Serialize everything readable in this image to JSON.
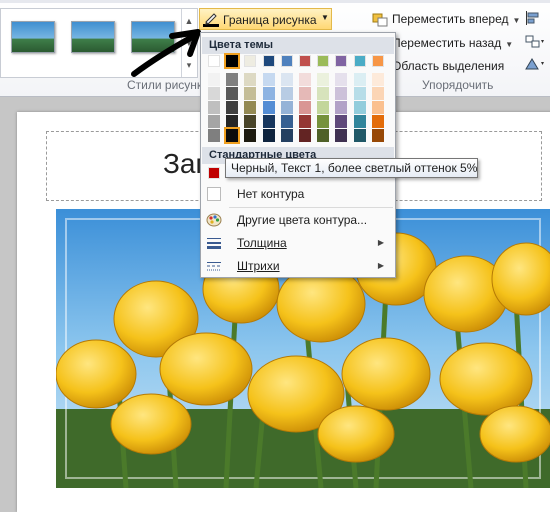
{
  "ribbon": {
    "picture_styles_group_label": "Стили рисунк",
    "arrange_group_label": "Упорядочить",
    "border_button_label": "Граница рисунка",
    "bring_forward_label": "Переместить вперед",
    "send_backward_label": "Переместить назад",
    "selection_pane_label": "Область выделения"
  },
  "menu": {
    "theme_colors_header": "Цвета темы",
    "standard_colors_header": "Стандартные цвета",
    "theme_top_colors": [
      "#ffffff",
      "#000000",
      "#eeece1",
      "#1f497d",
      "#4f81bd",
      "#c0504d",
      "#9bbb59",
      "#8064a2",
      "#4bacc6",
      "#f79646"
    ],
    "theme_shade_colors": [
      [
        "#f2f2f2",
        "#d8d8d8",
        "#bfbfbf",
        "#a5a5a5",
        "#7f7f7f"
      ],
      [
        "#7f7f7f",
        "#595959",
        "#3f3f3f",
        "#262626",
        "#0c0c0c"
      ],
      [
        "#ddd9c3",
        "#c4bd97",
        "#938953",
        "#494429",
        "#1d1b10"
      ],
      [
        "#c6d9f0",
        "#8db3e2",
        "#548dd4",
        "#17365d",
        "#0f243e"
      ],
      [
        "#dbe5f1",
        "#b8cce4",
        "#95b3d7",
        "#366092",
        "#244061"
      ],
      [
        "#f2dcdb",
        "#e5b9b7",
        "#d99694",
        "#953734",
        "#632423"
      ],
      [
        "#ebf1dd",
        "#d7e3bc",
        "#c3d69b",
        "#76923c",
        "#4f6128"
      ],
      [
        "#e5e0ec",
        "#ccc1d9",
        "#b2a2c7",
        "#5f497a",
        "#3f3151"
      ],
      [
        "#dbeef3",
        "#b7dde8",
        "#92cddc",
        "#31859b",
        "#205867"
      ],
      [
        "#fdeada",
        "#fbd5b5",
        "#fac08f",
        "#e36c09",
        "#974806"
      ]
    ],
    "standard_colors": [
      "#c00000"
    ],
    "no_outline_label": "Нет контура",
    "more_colors_label": "Другие цвета контура...",
    "weight_label": "Толщина",
    "dashes_label": "Штрихи"
  },
  "tooltip": {
    "text": "Черный, Текст 1, более светлый оттенок 5%"
  },
  "slide": {
    "title_text": "Заг"
  }
}
